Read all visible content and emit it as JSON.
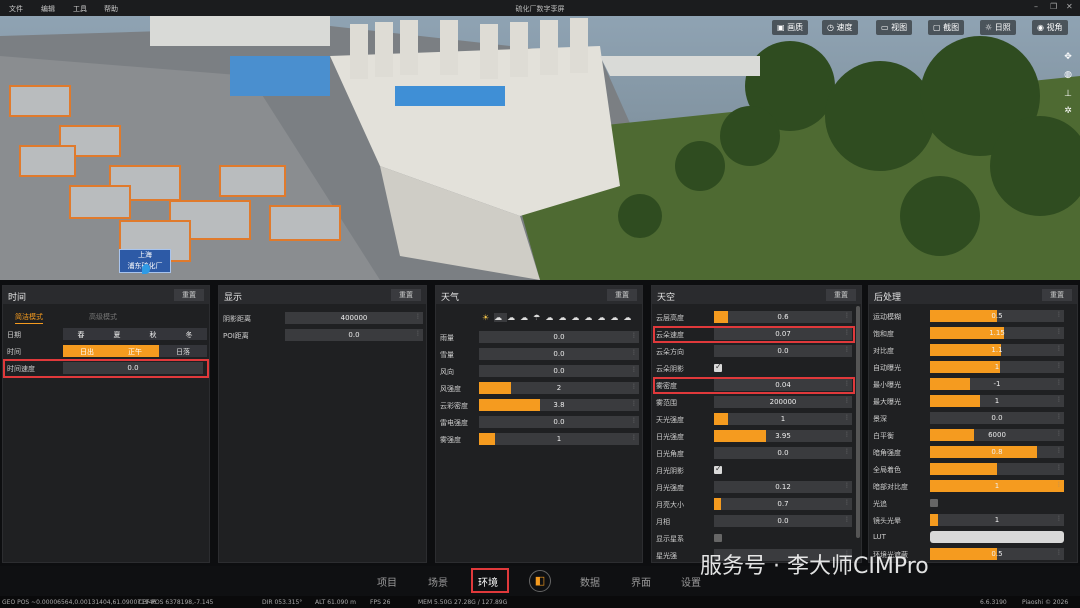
{
  "menu": {
    "items": [
      "文件",
      "编辑",
      "工具",
      "帮助"
    ],
    "title": "硫化厂数字孪屏"
  },
  "viewport_toolbar": [
    "画质",
    "速度",
    "视图",
    "截图",
    "日照",
    "视角"
  ],
  "viewport_label": {
    "line1": "上海",
    "line2": "浦东硫化厂"
  },
  "panels": {
    "time": {
      "title": "时间",
      "reset": "重置",
      "tabs": [
        "简洁模式",
        "高级模式"
      ],
      "date_label": "日期",
      "seasons": [
        "春",
        "夏",
        "秋",
        "冬"
      ],
      "time_label": "时间",
      "times": [
        "日出",
        "正午",
        "日落"
      ],
      "speed_label": "时间速度",
      "speed_value": "0.0"
    },
    "display": {
      "title": "显示",
      "reset": "重置",
      "rows": [
        {
          "label": "阴影距离",
          "value": "400000"
        },
        {
          "label": "POI距离",
          "value": "0.0"
        }
      ]
    },
    "weather": {
      "title": "天气",
      "reset": "重置",
      "rows": [
        {
          "label": "雨量",
          "value": "0.0",
          "fill": 0
        },
        {
          "label": "雪量",
          "value": "0.0",
          "fill": 0
        },
        {
          "label": "风向",
          "value": "0.0",
          "fill": 0
        },
        {
          "label": "风强度",
          "value": "2",
          "fill": 0.2
        },
        {
          "label": "云彩密度",
          "value": "3.8",
          "fill": 0.38
        },
        {
          "label": "雷电强度",
          "value": "0.0",
          "fill": 0
        },
        {
          "label": "雾强度",
          "value": "1",
          "fill": 0.1
        }
      ]
    },
    "sky": {
      "title": "天空",
      "reset": "重置",
      "rows": [
        {
          "label": "云层高度",
          "type": "slider",
          "value": "0.6",
          "fill": 0.1
        },
        {
          "label": "云朵速度",
          "type": "slider",
          "value": "0.07",
          "fill": 0
        },
        {
          "label": "云朵方向",
          "type": "slider",
          "value": "0.0",
          "fill": 0
        },
        {
          "label": "云朵阴影",
          "type": "check",
          "checked": true
        },
        {
          "label": "雾密度",
          "type": "slider",
          "value": "0.04",
          "fill": 0
        },
        {
          "label": "雾范围",
          "type": "slider",
          "value": "200000",
          "fill": 0
        },
        {
          "label": "天光强度",
          "type": "slider",
          "value": "1",
          "fill": 0.1
        },
        {
          "label": "日光强度",
          "type": "slider",
          "value": "3.95",
          "fill": 0.38
        },
        {
          "label": "日光角度",
          "type": "slider",
          "value": "0.0",
          "fill": 0
        },
        {
          "label": "月光阴影",
          "type": "check",
          "checked": true
        },
        {
          "label": "月光强度",
          "type": "slider",
          "value": "0.12",
          "fill": 0
        },
        {
          "label": "月亮大小",
          "type": "slider",
          "value": "0.7",
          "fill": 0.05
        },
        {
          "label": "月相",
          "type": "slider",
          "value": "0.0",
          "fill": 0
        },
        {
          "label": "显示星系",
          "type": "check",
          "checked": false
        },
        {
          "label": "星光强",
          "type": "slider",
          "value": "",
          "fill": 0
        }
      ]
    },
    "post": {
      "title": "后处理",
      "reset": "重置",
      "rows": [
        {
          "label": "运动模糊",
          "type": "slider",
          "value": "0.5",
          "fill": 0.5
        },
        {
          "label": "饱和度",
          "type": "slider",
          "value": "1.15",
          "fill": 0.55
        },
        {
          "label": "对比度",
          "type": "slider",
          "value": "1.1",
          "fill": 0.53
        },
        {
          "label": "自动曝光",
          "type": "slider",
          "value": "1",
          "fill": 0.52
        },
        {
          "label": "最小曝光",
          "type": "slider",
          "value": "-1",
          "fill": 0.3
        },
        {
          "label": "最大曝光",
          "type": "slider",
          "value": "1",
          "fill": 0.37
        },
        {
          "label": "景深",
          "type": "slider",
          "value": "0.0",
          "fill": 0
        },
        {
          "label": "白平衡",
          "type": "slider",
          "value": "6000",
          "fill": 0.33
        },
        {
          "label": "暗角强度",
          "type": "slider",
          "value": "0.8",
          "fill": 0.8
        },
        {
          "label": "全局着色",
          "type": "slider",
          "value": "",
          "fill": 0.5
        },
        {
          "label": "暗部对比度",
          "type": "slider",
          "value": "1",
          "fill": 1.0
        },
        {
          "label": "光追",
          "type": "check",
          "checked": false
        },
        {
          "label": "镜头光晕",
          "type": "slider",
          "value": "1",
          "fill": 0.06
        },
        {
          "label": "LUT",
          "type": "blank"
        },
        {
          "label": "环境光遮蔽",
          "type": "slider",
          "value": "0.5",
          "fill": 0.5
        }
      ]
    }
  },
  "bottom_tabs": [
    "项目",
    "场景",
    "环境",
    "数据",
    "界面",
    "设置"
  ],
  "status": {
    "geo_pos": "GEO POS ~0.00006564,0.00131404,61.090071946",
    "cef_pos": "CEF POS 6378198,-7.145",
    "dir": "DIR 053.315°",
    "alt": "ALT 61.090 m",
    "fps": "FPS 26",
    "mem": "MEM 5.50G 27.28G / 127.89G",
    "version": "6.6.3190",
    "copyright": "Piaoshi © 2026"
  },
  "watermark": "服务号 · 李大师CIMPro",
  "colors": {
    "accent": "#f59b1f",
    "highlight": "#e0393b"
  }
}
